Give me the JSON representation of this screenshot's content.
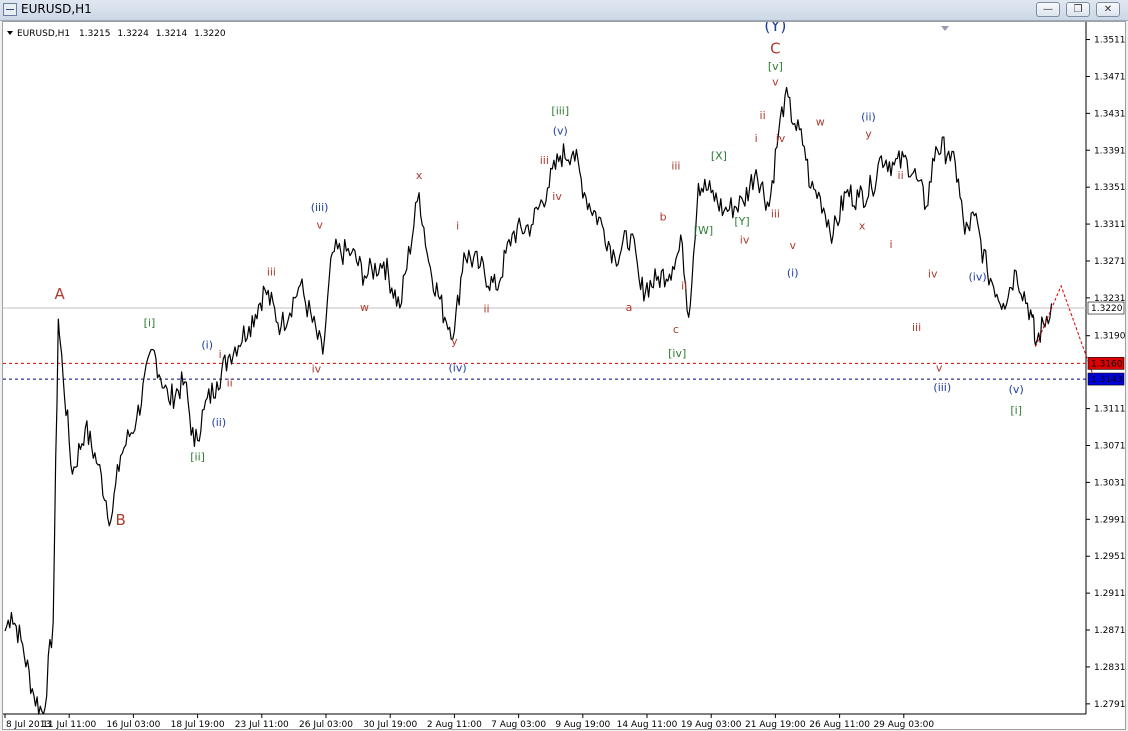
{
  "window": {
    "title": "EURUSD,H1",
    "buttons": [
      "minimize",
      "restore",
      "close"
    ]
  },
  "chart_info": {
    "symbol": "EURUSD,H1",
    "open": "1.3215",
    "high": "1.3224",
    "low": "1.3214",
    "close": "1.3220"
  },
  "chart_data": {
    "type": "line",
    "title": "EURUSD,H1  1.3215 1.3224 1.3214 1.3220",
    "x_ticks": [
      "8 Jul 2013",
      "11 Jul 11:00",
      "16 Jul 03:00",
      "18 Jul 19:00",
      "23 Jul 11:00",
      "26 Jul 03:00",
      "30 Jul 19:00",
      "2 Aug 11:00",
      "7 Aug 03:00",
      "9 Aug 19:00",
      "14 Aug 11:00",
      "19 Aug 03:00",
      "21 Aug 19:00",
      "26 Aug 11:00",
      "29 Aug 03:00"
    ],
    "y_ticks": [
      "1.3511",
      "1.3471",
      "1.3431",
      "1.3391",
      "1.3351",
      "1.3311",
      "1.3271",
      "1.3231",
      "1.3190",
      "1.3111",
      "1.3071",
      "1.3031",
      "1.2991",
      "1.2951",
      "1.2911",
      "1.2871",
      "1.2831",
      "1.2791"
    ],
    "ylim": [
      1.278,
      1.353
    ],
    "grid": false,
    "series": [
      {
        "x": [
          "8 Jul 2013",
          "11 Jul 11:00",
          "16 Jul 03:00",
          "18 Jul 19:00",
          "23 Jul 11:00",
          "26 Jul 03:00",
          "30 Jul 19:00",
          "2 Aug 11:00",
          "7 Aug 03:00",
          "9 Aug 19:00",
          "14 Aug 11:00",
          "19 Aug 03:00",
          "21 Aug 19:00",
          "26 Aug 11:00",
          "29 Aug 03:00"
        ],
        "points": [
          [
            0,
            1.287
          ],
          [
            0.1,
            1.289
          ],
          [
            0.25,
            1.286
          ],
          [
            0.45,
            1.28
          ],
          [
            0.6,
            1.278
          ],
          [
            0.75,
            1.288
          ],
          [
            0.83,
            1.3208
          ],
          [
            0.9,
            1.315
          ],
          [
            1.05,
            1.304
          ],
          [
            1.25,
            1.309
          ],
          [
            1.45,
            1.305
          ],
          [
            1.65,
            1.299
          ],
          [
            1.8,
            1.306
          ],
          [
            2.05,
            1.31
          ],
          [
            2.3,
            1.3175
          ],
          [
            2.55,
            1.312
          ],
          [
            2.8,
            1.314
          ],
          [
            2.95,
            1.307
          ],
          [
            3.1,
            1.311
          ],
          [
            3.3,
            1.314
          ],
          [
            3.5,
            1.317
          ],
          [
            3.8,
            1.32
          ],
          [
            4.05,
            1.324
          ],
          [
            4.3,
            1.32
          ],
          [
            4.6,
            1.3245
          ],
          [
            4.95,
            1.317
          ],
          [
            5.1,
            1.328
          ],
          [
            5.4,
            1.328
          ],
          [
            5.6,
            1.3255
          ],
          [
            5.9,
            1.327
          ],
          [
            6.15,
            1.322
          ],
          [
            6.45,
            1.3345
          ],
          [
            6.6,
            1.327
          ],
          [
            6.85,
            1.321
          ],
          [
            7.0,
            1.3195
          ],
          [
            7.15,
            1.328
          ],
          [
            7.4,
            1.3265
          ],
          [
            7.65,
            1.324
          ],
          [
            7.9,
            1.33
          ],
          [
            8.2,
            1.331
          ],
          [
            8.45,
            1.335
          ],
          [
            8.65,
            1.3385
          ],
          [
            8.85,
            1.339
          ],
          [
            9.05,
            1.334
          ],
          [
            9.3,
            1.331
          ],
          [
            9.5,
            1.3275
          ],
          [
            9.75,
            1.33
          ],
          [
            9.9,
            1.324
          ],
          [
            10.15,
            1.325
          ],
          [
            10.4,
            1.3265
          ],
          [
            10.55,
            1.329
          ],
          [
            10.65,
            1.321
          ],
          [
            10.8,
            1.3355
          ],
          [
            11.0,
            1.3345
          ],
          [
            11.2,
            1.3325
          ],
          [
            11.5,
            1.3335
          ],
          [
            11.7,
            1.337
          ],
          [
            11.9,
            1.333
          ],
          [
            12.05,
            1.341
          ],
          [
            12.15,
            1.345
          ],
          [
            12.3,
            1.342
          ],
          [
            12.45,
            1.3395
          ],
          [
            12.55,
            1.335
          ],
          [
            12.7,
            1.334
          ],
          [
            12.9,
            1.33
          ],
          [
            13.1,
            1.3345
          ],
          [
            13.3,
            1.334
          ],
          [
            13.5,
            1.335
          ],
          [
            13.65,
            1.3385
          ],
          [
            13.85,
            1.3375
          ],
          [
            14.05,
            1.338
          ],
          [
            14.2,
            1.336
          ],
          [
            14.35,
            1.333
          ],
          [
            14.5,
            1.3395
          ],
          [
            14.7,
            1.339
          ],
          [
            14.85,
            1.336
          ],
          [
            14.95,
            1.33
          ],
          [
            15.1,
            1.332
          ],
          [
            15.3,
            1.326
          ],
          [
            15.55,
            1.3225
          ],
          [
            15.75,
            1.326
          ],
          [
            16.0,
            1.321
          ],
          [
            16.05,
            1.318
          ],
          [
            16.3,
            1.3225
          ]
        ]
      }
    ],
    "projection": {
      "x": [
        16.05,
        16.45,
        16.95
      ],
      "y": [
        1.3178,
        1.3244,
        1.3147
      ]
    },
    "price_lines": [
      {
        "value": 1.322,
        "label": "1.3220",
        "style": "solid",
        "color": "#c0c0c0",
        "badge_bg": "#ffffff",
        "badge_fg": "#000000"
      },
      {
        "value": 1.316,
        "label": "1.3160",
        "style": "dashed",
        "color": "#dd0000",
        "badge_bg": "#dd0000",
        "badge_fg": "#ffffff"
      },
      {
        "value": 1.3143,
        "label": "1.3143",
        "style": "dashed",
        "color": "#000080",
        "badge_bg": "#0000dd",
        "badge_fg": "#ffffff"
      }
    ],
    "annotations": [
      {
        "text": "(Y)",
        "x": 12.0,
        "y": 1.352,
        "color": "#1f3f9f",
        "size": 16
      },
      {
        "text": "C",
        "x": 12.0,
        "y": 1.3496,
        "color": "#b03a2e",
        "size": 15
      },
      {
        "text": "[v]",
        "x": 12.0,
        "y": 1.3478,
        "color": "#2e7d32",
        "size": 11
      },
      {
        "text": "v",
        "x": 12.0,
        "y": 1.3461,
        "color": "#b03a2e",
        "size": 11
      },
      {
        "text": "A",
        "x": 0.85,
        "y": 1.323,
        "color": "#b03a2e",
        "size": 15
      },
      {
        "text": "B",
        "x": 1.8,
        "y": 1.2985,
        "color": "#b03a2e",
        "size": 15
      },
      {
        "text": "[i]",
        "x": 2.25,
        "y": 1.32,
        "color": "#2e7d32",
        "size": 11
      },
      {
        "text": "[ii]",
        "x": 3.0,
        "y": 1.3055,
        "color": "#2e7d32",
        "size": 11
      },
      {
        "text": "(i)",
        "x": 3.15,
        "y": 1.3176,
        "color": "#1f3f9f",
        "size": 11
      },
      {
        "text": "(ii)",
        "x": 3.33,
        "y": 1.3092,
        "color": "#1f3f9f",
        "size": 11
      },
      {
        "text": "i",
        "x": 3.35,
        "y": 1.3166,
        "color": "#b03a2e",
        "size": 11
      },
      {
        "text": "ii",
        "x": 3.5,
        "y": 1.3135,
        "color": "#b03a2e",
        "size": 11
      },
      {
        "text": "iii",
        "x": 4.15,
        "y": 1.3255,
        "color": "#b03a2e",
        "size": 11
      },
      {
        "text": "(iii)",
        "x": 4.9,
        "y": 1.3325,
        "color": "#1f3f9f",
        "size": 11
      },
      {
        "text": "v",
        "x": 4.9,
        "y": 1.3306,
        "color": "#b03a2e",
        "size": 11
      },
      {
        "text": "iv",
        "x": 4.85,
        "y": 1.315,
        "color": "#b03a2e",
        "size": 11
      },
      {
        "text": "w",
        "x": 5.6,
        "y": 1.3217,
        "color": "#b03a2e",
        "size": 11
      },
      {
        "text": "x",
        "x": 6.45,
        "y": 1.336,
        "color": "#b03a2e",
        "size": 11
      },
      {
        "text": "y",
        "x": 7.0,
        "y": 1.318,
        "color": "#b03a2e",
        "size": 11
      },
      {
        "text": "(iv)",
        "x": 7.05,
        "y": 1.3151,
        "color": "#1f3f9f",
        "size": 11
      },
      {
        "text": "i",
        "x": 7.05,
        "y": 1.3305,
        "color": "#b03a2e",
        "size": 11
      },
      {
        "text": "ii",
        "x": 7.5,
        "y": 1.3215,
        "color": "#b03a2e",
        "size": 11
      },
      {
        "text": "[iii]",
        "x": 8.65,
        "y": 1.343,
        "color": "#2e7d32",
        "size": 11
      },
      {
        "text": "(v)",
        "x": 8.65,
        "y": 1.3408,
        "color": "#1f3f9f",
        "size": 11
      },
      {
        "text": "iii",
        "x": 8.4,
        "y": 1.3376,
        "color": "#b03a2e",
        "size": 11
      },
      {
        "text": "iv",
        "x": 8.6,
        "y": 1.3337,
        "color": "#b03a2e",
        "size": 11
      },
      {
        "text": "a",
        "x": 9.72,
        "y": 1.3217,
        "color": "#b03a2e",
        "size": 11
      },
      {
        "text": "b",
        "x": 10.25,
        "y": 1.3315,
        "color": "#b03a2e",
        "size": 11
      },
      {
        "text": "c",
        "x": 10.45,
        "y": 1.3193,
        "color": "#b03a2e",
        "size": 11
      },
      {
        "text": "[iv]",
        "x": 10.47,
        "y": 1.3167,
        "color": "#2e7d32",
        "size": 11
      },
      {
        "text": "iii",
        "x": 10.45,
        "y": 1.337,
        "color": "#b03a2e",
        "size": 11
      },
      {
        "text": "ii",
        "x": 10.58,
        "y": 1.324,
        "color": "#b03a2e",
        "size": 11
      },
      {
        "text": "[X]",
        "x": 11.12,
        "y": 1.3381,
        "color": "#2e7d32",
        "size": 11
      },
      {
        "text": "[W]",
        "x": 10.88,
        "y": 1.33,
        "color": "#2e7d32",
        "size": 11
      },
      {
        "text": "[Y]",
        "x": 11.48,
        "y": 1.331,
        "color": "#2e7d32",
        "size": 11
      },
      {
        "text": "iv",
        "x": 11.52,
        "y": 1.329,
        "color": "#b03a2e",
        "size": 11
      },
      {
        "text": "i",
        "x": 11.7,
        "y": 1.34,
        "color": "#b03a2e",
        "size": 11
      },
      {
        "text": "ii",
        "x": 11.8,
        "y": 1.3425,
        "color": "#b03a2e",
        "size": 11
      },
      {
        "text": "iii",
        "x": 12.0,
        "y": 1.3318,
        "color": "#b03a2e",
        "size": 11
      },
      {
        "text": "iv",
        "x": 12.08,
        "y": 1.34,
        "color": "#b03a2e",
        "size": 11
      },
      {
        "text": "v",
        "x": 12.27,
        "y": 1.3284,
        "color": "#b03a2e",
        "size": 11
      },
      {
        "text": "(i)",
        "x": 12.27,
        "y": 1.3254,
        "color": "#1f3f9f",
        "size": 11
      },
      {
        "text": "w",
        "x": 12.7,
        "y": 1.3418,
        "color": "#b03a2e",
        "size": 11
      },
      {
        "text": "x",
        "x": 13.35,
        "y": 1.3305,
        "color": "#b03a2e",
        "size": 11
      },
      {
        "text": "(ii)",
        "x": 13.45,
        "y": 1.3423,
        "color": "#1f3f9f",
        "size": 11
      },
      {
        "text": "y",
        "x": 13.45,
        "y": 1.3405,
        "color": "#b03a2e",
        "size": 11
      },
      {
        "text": "ii",
        "x": 13.95,
        "y": 1.336,
        "color": "#b03a2e",
        "size": 11
      },
      {
        "text": "i",
        "x": 13.8,
        "y": 1.3285,
        "color": "#b03a2e",
        "size": 11
      },
      {
        "text": "iv",
        "x": 14.45,
        "y": 1.3253,
        "color": "#b03a2e",
        "size": 11
      },
      {
        "text": "iii",
        "x": 14.2,
        "y": 1.3195,
        "color": "#b03a2e",
        "size": 11
      },
      {
        "text": "v",
        "x": 14.55,
        "y": 1.3151,
        "color": "#b03a2e",
        "size": 11
      },
      {
        "text": "(iii)",
        "x": 14.6,
        "y": 1.313,
        "color": "#1f3f9f",
        "size": 11
      },
      {
        "text": "(iv)",
        "x": 15.15,
        "y": 1.325,
        "color": "#1f3f9f",
        "size": 11
      },
      {
        "text": "(v)",
        "x": 15.75,
        "y": 1.3128,
        "color": "#1f3f9f",
        "size": 11
      },
      {
        "text": "[i]",
        "x": 15.75,
        "y": 1.3105,
        "color": "#2e7d32",
        "size": 11
      }
    ]
  }
}
